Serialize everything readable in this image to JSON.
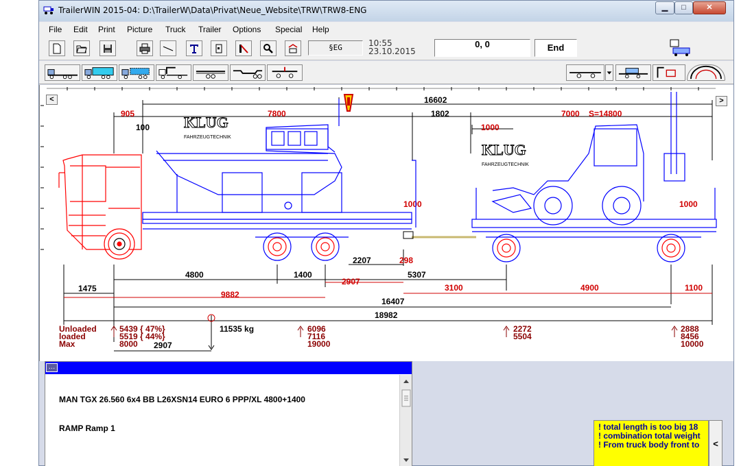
{
  "window": {
    "title": "TrailerWIN 2015-04:  D:\\TrailerW\\Data\\Privat\\Neue_Website\\TRW\\TRW8-ENG",
    "min_glyph": "▁",
    "max_glyph": "□",
    "close_glyph": "✕"
  },
  "menu": [
    "File",
    "Edit",
    "Print",
    "Picture",
    "Truck",
    "Trailer",
    "Options",
    "Special",
    "Help"
  ],
  "toolbar": {
    "buttons": [
      "new-file-icon",
      "open-folder-icon",
      "save-icon",
      "print-icon",
      "line-tool-icon",
      "text-tool-icon",
      "frame-tool-icon",
      "dimension-tool-icon",
      "zoom-icon",
      "measure-icon"
    ],
    "seg_value": "§EG",
    "time": "10:55",
    "date": "23.10.2015",
    "coordinates": "0, 0",
    "end_label": "End"
  },
  "vehicle_toolbar": {
    "left_buttons": [
      "flatbed-trailer-icon",
      "box-trailer-icon",
      "container-trailer-icon",
      "crane-truck-icon",
      "tandem-trailer-icon",
      "lowbed-trailer-icon",
      "dolly-icon"
    ],
    "right_buttons": [
      "trailer-select-icon",
      "dropdown-icon",
      "load-trailer-icon",
      "crane-load-icon",
      "turning-circle-icon"
    ]
  },
  "drawing": {
    "dims_top": {
      "total": "16602",
      "overhang_front": "905",
      "gap_small": "100",
      "body_length": "7800",
      "coupling_gap": "1802",
      "trailer_body": "7000",
      "total_body": "S=14800",
      "trailer_offset": "1000",
      "ramp_height_left": "1000",
      "ramp_height_right": "1000"
    },
    "dims_bottom": {
      "wheelbase": "4800",
      "tandem": "1400",
      "front_overhang": "1475",
      "coupling_x": "2207",
      "coupling_y": "298",
      "coupling_to_axle": "2907",
      "drawbar": "5307",
      "trailer_front": "3100",
      "trailer_wheelbase": "4900",
      "trailer_rear": "1100",
      "truck_length": "9882",
      "axle_span": "16407",
      "overall": "18982"
    },
    "logo_text": "KLUG",
    "logo_sub": "FAHRZEUGTECHNIK",
    "loads": {
      "labels": [
        "Unloaded",
        "loaded",
        "Max"
      ],
      "front_axle": [
        "5439 { 47%}",
        "5519 { 44%}",
        "8000"
      ],
      "cg_weight": "11535 kg",
      "cg_distance": "2907",
      "rear_axle": [
        "6096",
        "7116",
        "19000"
      ],
      "trailer_front_axle": [
        "2272",
        "5504"
      ],
      "trailer_rear_axle": [
        "2888",
        "8456",
        "10000"
      ]
    }
  },
  "description_panel": {
    "lines": [
      "MAN TGX 26.560 6x4 BB  L26XSN14 EURO 6 PPP/XL 4800+1400",
      "RAMP  Ramp 1"
    ]
  },
  "warnings": [
    "! total length is too big  18",
    "! combination total weight",
    "! From truck body front to"
  ],
  "warning_toggle": "<",
  "colors": {
    "truck": "#ff0000",
    "trailer": "#0000ff",
    "dimension": "#000000",
    "dimension_red": "#d00000",
    "load_text": "#8b0000",
    "warning_bg": "#ffff00"
  }
}
